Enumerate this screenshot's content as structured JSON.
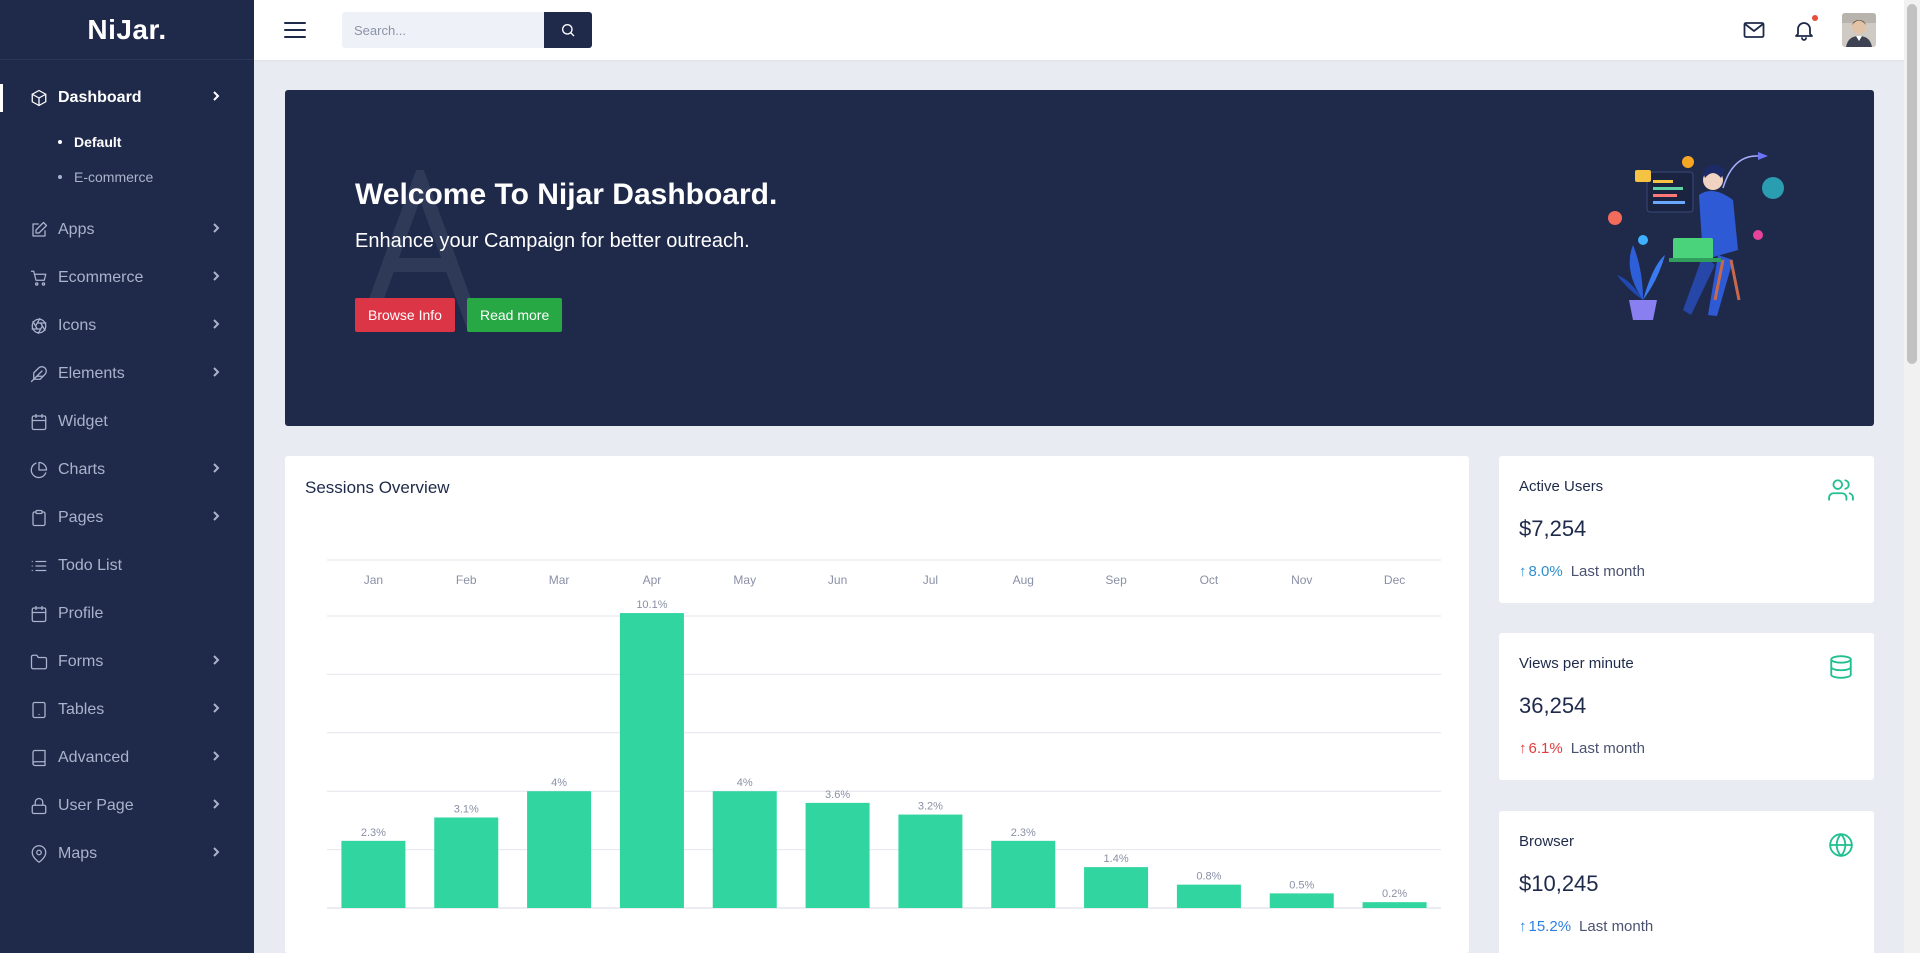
{
  "brand": {
    "logo": "NiJar."
  },
  "sidebar": {
    "items": [
      {
        "label": "Dashboard",
        "icon": "box-icon",
        "active": true,
        "chevron": true,
        "sub": [
          {
            "label": "Default",
            "active": true
          },
          {
            "label": "E-commerce",
            "active": false
          }
        ]
      },
      {
        "label": "Apps",
        "icon": "edit-icon",
        "chevron": true
      },
      {
        "label": "Ecommerce",
        "icon": "cart-icon",
        "chevron": true
      },
      {
        "label": "Icons",
        "icon": "aperture-icon",
        "chevron": true
      },
      {
        "label": "Elements",
        "icon": "feather-icon",
        "chevron": true
      },
      {
        "label": "Widget",
        "icon": "calendar-icon",
        "chevron": false
      },
      {
        "label": "Charts",
        "icon": "pie-chart-icon",
        "chevron": true
      },
      {
        "label": "Pages",
        "icon": "clipboard-icon",
        "chevron": true
      },
      {
        "label": "Todo List",
        "icon": "list-icon",
        "chevron": false
      },
      {
        "label": "Profile",
        "icon": "calendar-icon",
        "chevron": false
      },
      {
        "label": "Forms",
        "icon": "folder-icon",
        "chevron": true
      },
      {
        "label": "Tables",
        "icon": "tablet-icon",
        "chevron": true
      },
      {
        "label": "Advanced",
        "icon": "book-icon",
        "chevron": true
      },
      {
        "label": "User Page",
        "icon": "lock-icon",
        "chevron": true
      },
      {
        "label": "Maps",
        "icon": "map-pin-icon",
        "chevron": true
      }
    ]
  },
  "topbar": {
    "search_placeholder": "Search..."
  },
  "banner": {
    "title": "Welcome To Nijar Dashboard.",
    "subtitle": "Enhance your Campaign for better outreach.",
    "browse_label": "Browse Info",
    "read_label": "Read more"
  },
  "sessions": {
    "title": "Sessions Overview"
  },
  "chart_data": {
    "type": "bar",
    "categories": [
      "Jan",
      "Feb",
      "Mar",
      "Apr",
      "May",
      "Jun",
      "Jul",
      "Aug",
      "Sep",
      "Oct",
      "Nov",
      "Dec"
    ],
    "values": [
      2.3,
      3.1,
      4,
      10.1,
      4,
      3.6,
      3.2,
      2.3,
      1.4,
      0.8,
      0.5,
      0.2
    ],
    "data_labels": [
      "2.3%",
      "3.1%",
      "4%",
      "10.1%",
      "4%",
      "3.6%",
      "3.2%",
      "2.3%",
      "1.4%",
      "0.8%",
      "0.5%",
      "0.2%"
    ],
    "ylim": [
      0,
      10
    ],
    "color": "#30d5a0",
    "grid": true,
    "category_axis_position": "top"
  },
  "stats": [
    {
      "title": "Active Users",
      "value": "$7,254",
      "pct": "8.0%",
      "arrow": "↑",
      "trend_color": "#2f8fcf",
      "note": "Last month",
      "icon": "users-icon"
    },
    {
      "title": "Views per minute",
      "value": "36,254",
      "pct": "6.1%",
      "arrow": "↑",
      "trend_color": "#e23c3c",
      "note": "Last month",
      "icon": "database-icon"
    },
    {
      "title": "Browser",
      "value": "$10,245",
      "pct": "15.2%",
      "arrow": "↑",
      "trend_color": "#2f7fe0",
      "note": "Last month",
      "icon": "globe-icon"
    }
  ],
  "colors": {
    "sidebar_bg": "#1f2a4b",
    "accent": "#30d5a0",
    "page_bg": "#e9ebf3"
  }
}
